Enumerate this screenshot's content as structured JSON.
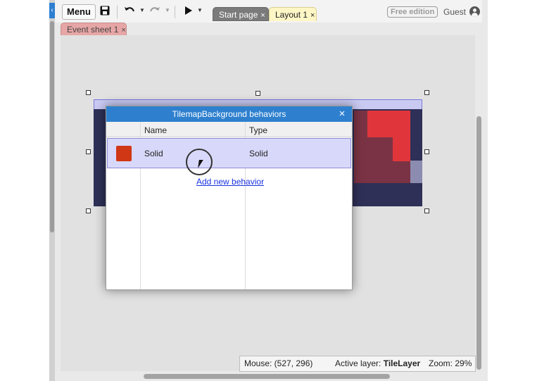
{
  "toolbar": {
    "menu_label": "Menu",
    "icons": [
      "save-icon",
      "undo-icon",
      "redo-icon",
      "play-icon"
    ]
  },
  "tabs": [
    {
      "label": "Start page",
      "close": "×"
    },
    {
      "label": "Layout 1",
      "close": "×"
    }
  ],
  "secondary_tabs": [
    {
      "label": "Event sheet 1",
      "close": "×"
    }
  ],
  "account": {
    "edition": "Free edition",
    "user": "Guest"
  },
  "dialog": {
    "title": "TilemapBackground behaviors",
    "close": "×",
    "columns": {
      "name": "Name",
      "type": "Type"
    },
    "rows": [
      {
        "name": "Solid",
        "type": "Solid",
        "color": "#d03815"
      }
    ],
    "add_link": "Add new behavior"
  },
  "status": {
    "mouse": "Mouse: (527, 296)",
    "layer_label": "Active layer:",
    "layer_value": "TileLayer",
    "zoom": "Zoom: 29%"
  },
  "colors": {
    "accent": "#2e80cf",
    "tab_layout": "#fff6c6",
    "tab_event": "#e7a6a6",
    "selection": "#d8d8fb"
  }
}
